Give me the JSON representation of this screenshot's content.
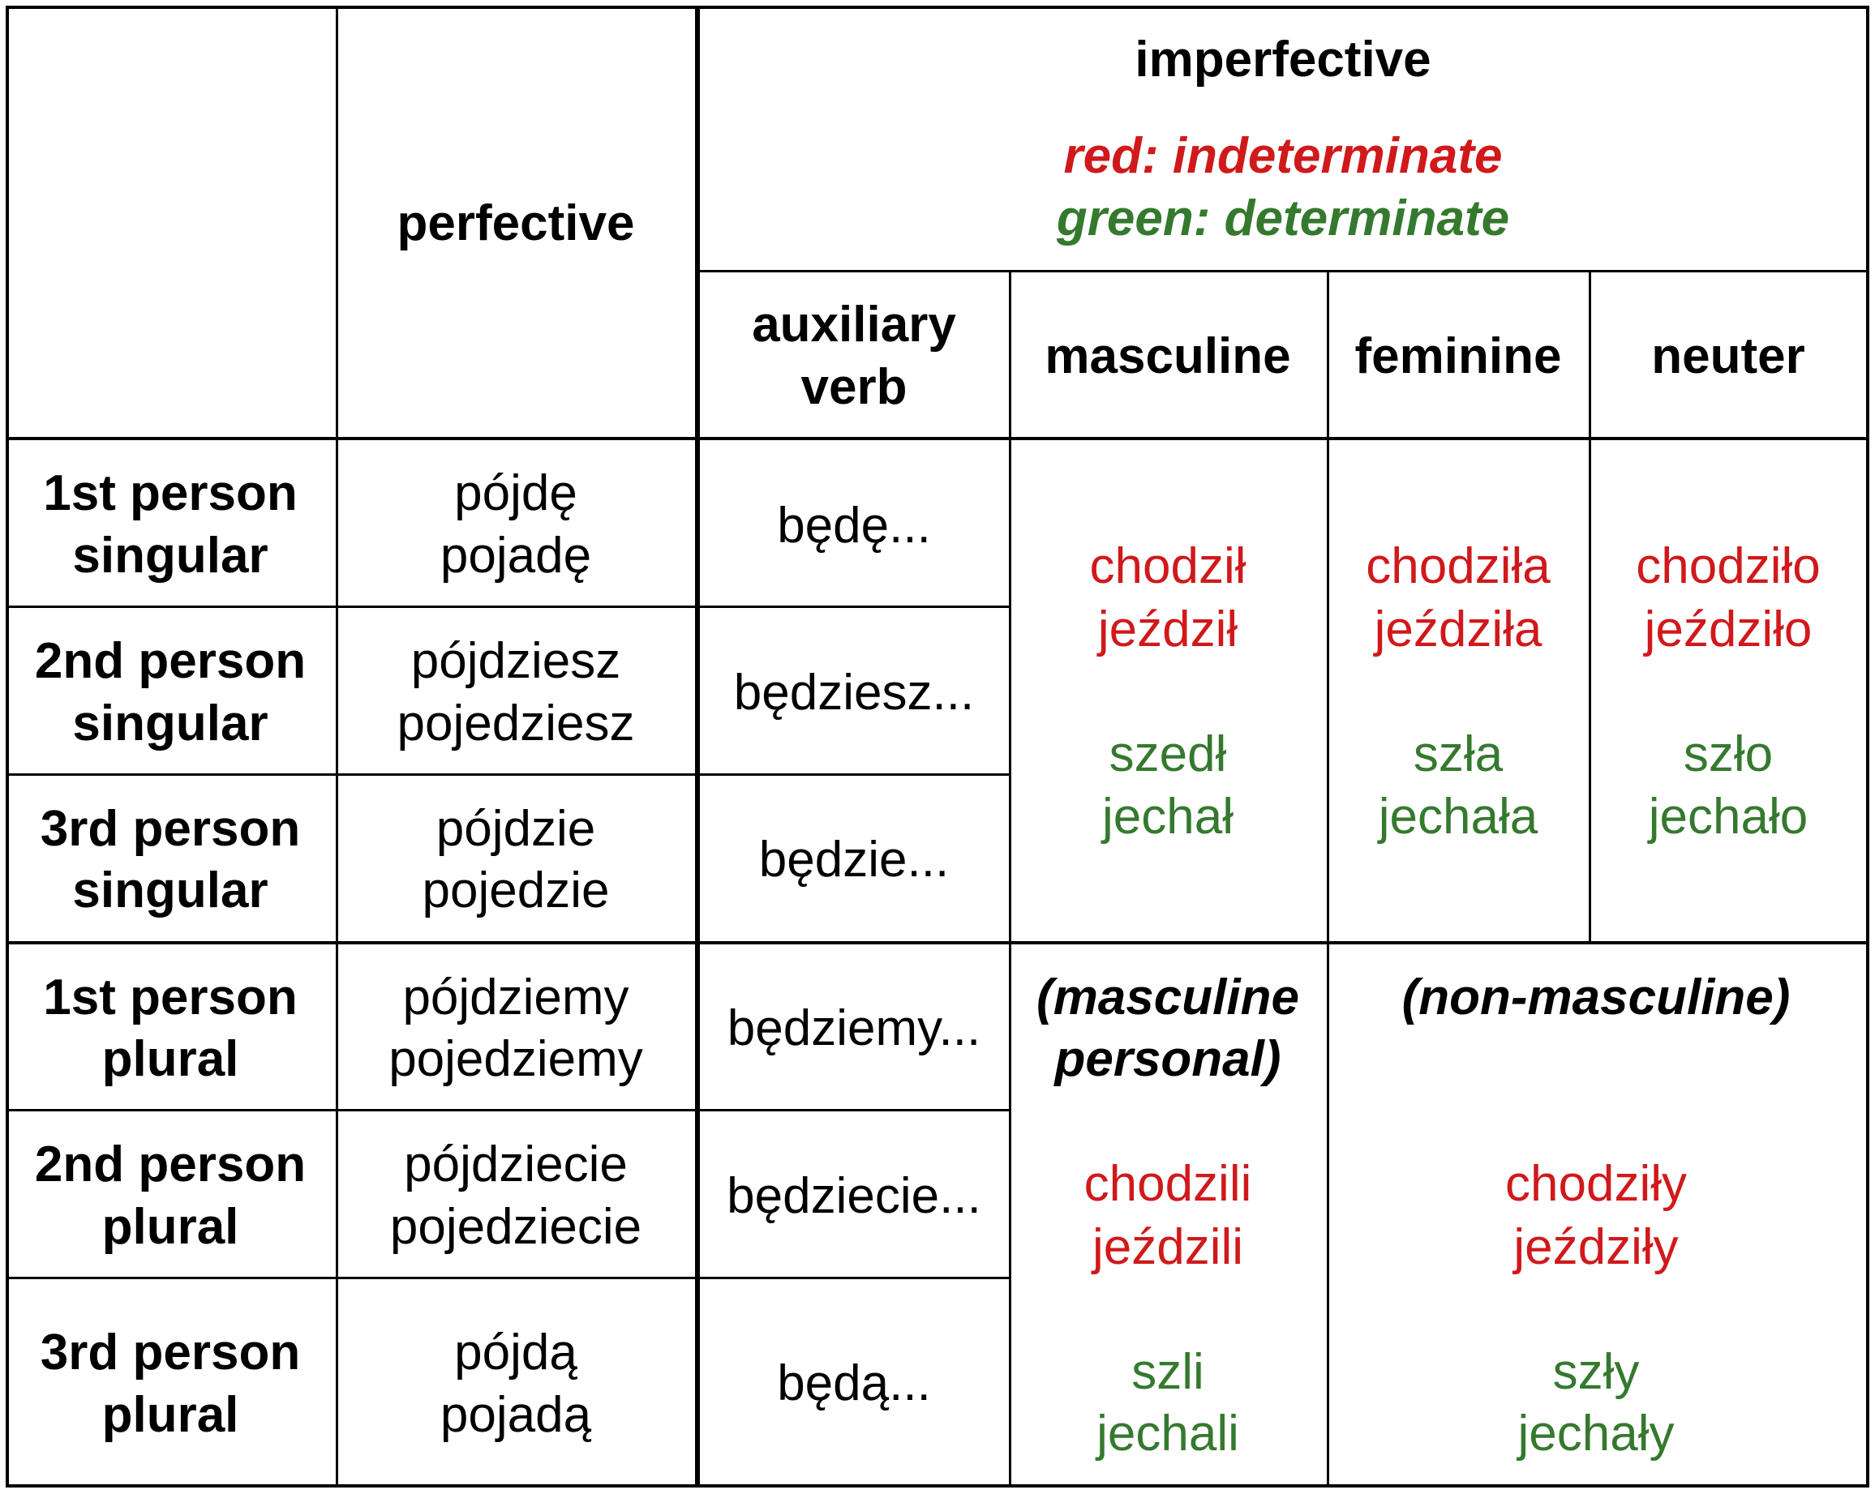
{
  "colors": {
    "indeterminate": "#D0191B",
    "determinate": "#35792E",
    "text": "#000000",
    "border": "#000000"
  },
  "header": {
    "perfective": "perfective",
    "imperfective": "imperfective",
    "legend_red": "red: indeterminate",
    "legend_green": "green: determinate",
    "auxiliary_line1": "auxiliary",
    "auxiliary_line2": "verb",
    "masculine": "masculine",
    "feminine": "feminine",
    "neuter": "neuter"
  },
  "rows": [
    {
      "person_line1": "1st person",
      "person_line2": "singular",
      "perfective": [
        "pójdę",
        "pojadę"
      ],
      "auxiliary": "będę..."
    },
    {
      "person_line1": "2nd person",
      "person_line2": "singular",
      "perfective": [
        "pójdziesz",
        "pojedziesz"
      ],
      "auxiliary": "będziesz..."
    },
    {
      "person_line1": "3rd person",
      "person_line2": "singular",
      "perfective": [
        "pójdzie",
        "pojedzie"
      ],
      "auxiliary": "będzie..."
    },
    {
      "person_line1": "1st person",
      "person_line2": "plural",
      "perfective": [
        "pójdziemy",
        "pojedziemy"
      ],
      "auxiliary": "będziemy..."
    },
    {
      "person_line1": "2nd person",
      "person_line2": "plural",
      "perfective": [
        "pójdziecie",
        "pojedziecie"
      ],
      "auxiliary": "będziecie..."
    },
    {
      "person_line1": "3rd person",
      "person_line2": "plural",
      "perfective": [
        "pójdą",
        "pojadą"
      ],
      "auxiliary": "będą..."
    }
  ],
  "singular_forms": {
    "masculine": {
      "indeterminate": [
        "chodził",
        "jeździł"
      ],
      "determinate": [
        "szedł",
        "jechał"
      ]
    },
    "feminine": {
      "indeterminate": [
        "chodziła",
        "jeździła"
      ],
      "determinate": [
        "szła",
        "jechała"
      ]
    },
    "neuter": {
      "indeterminate": [
        "chodziło",
        "jeździło"
      ],
      "determinate": [
        "szło",
        "jechało"
      ]
    }
  },
  "plural_forms": {
    "masculine_personal": {
      "label_line1": "(masculine",
      "label_line2": "personal)",
      "indeterminate": [
        "chodzili",
        "jeździli"
      ],
      "determinate": [
        "szli",
        "jechali"
      ]
    },
    "non_masculine": {
      "label": "(non-masculine)",
      "indeterminate": [
        "chodziły",
        "jeździły"
      ],
      "determinate": [
        "szły",
        "jechały"
      ]
    }
  }
}
